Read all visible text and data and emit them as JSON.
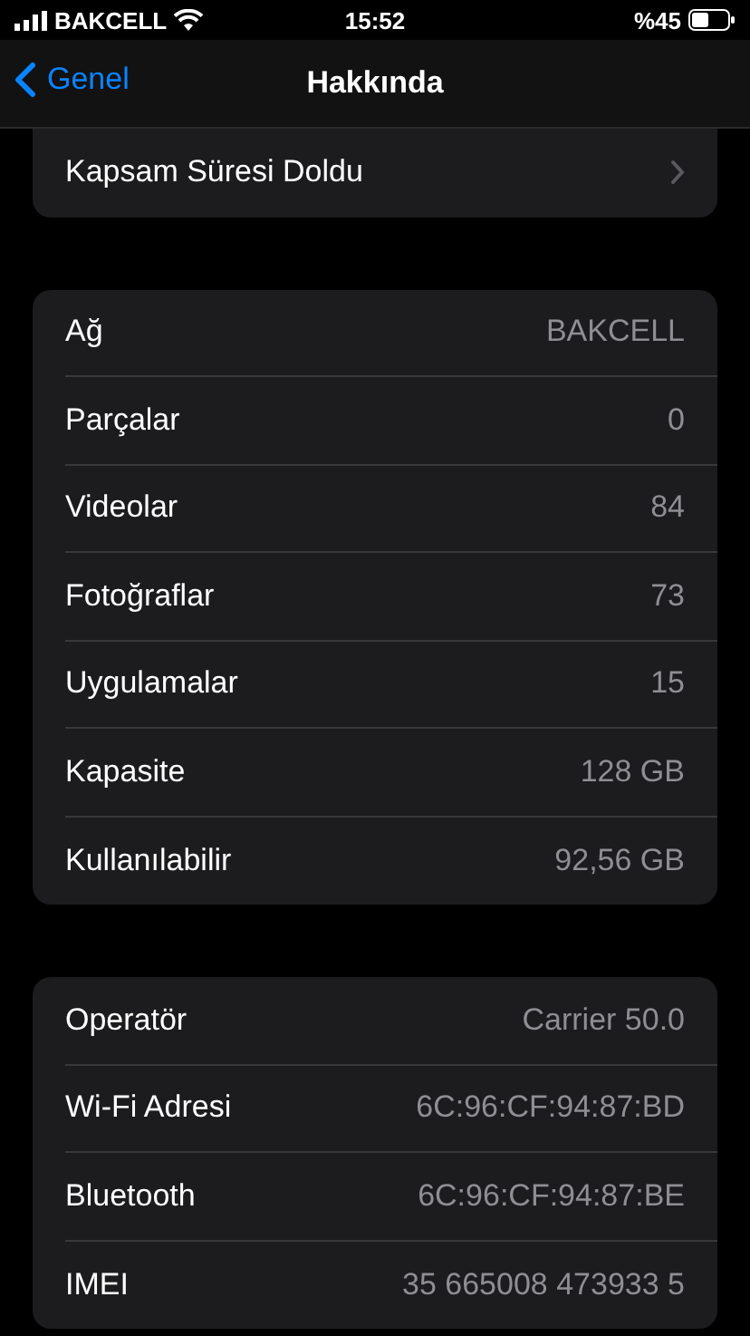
{
  "status_bar": {
    "carrier": "BAKCELL",
    "time": "15:52",
    "battery": "%45"
  },
  "nav": {
    "back": "Genel",
    "title": "Hakkında"
  },
  "groups": [
    {
      "rows": [
        {
          "kind": "link",
          "label": "Kapsam Süresi Doldu"
        }
      ]
    },
    {
      "rows": [
        {
          "kind": "value",
          "label": "Ağ",
          "value": "BAKCELL"
        },
        {
          "kind": "value",
          "label": "Parçalar",
          "value": "0"
        },
        {
          "kind": "value",
          "label": "Videolar",
          "value": "84"
        },
        {
          "kind": "value",
          "label": "Fotoğraflar",
          "value": "73"
        },
        {
          "kind": "value",
          "label": "Uygulamalar",
          "value": "15"
        },
        {
          "kind": "value",
          "label": "Kapasite",
          "value": "128 GB"
        },
        {
          "kind": "value",
          "label": "Kullanılabilir",
          "value": "92,56 GB"
        }
      ]
    },
    {
      "rows": [
        {
          "kind": "value",
          "label": "Operatör",
          "value": "Carrier 50.0"
        },
        {
          "kind": "value",
          "label": "Wi-Fi Adresi",
          "value": "6C:96:CF:94:87:BD"
        },
        {
          "kind": "value",
          "label": "Bluetooth",
          "value": "6C:96:CF:94:87:BE"
        },
        {
          "kind": "value",
          "label": "IMEI",
          "value": "35 665008 473933 5"
        }
      ]
    }
  ]
}
